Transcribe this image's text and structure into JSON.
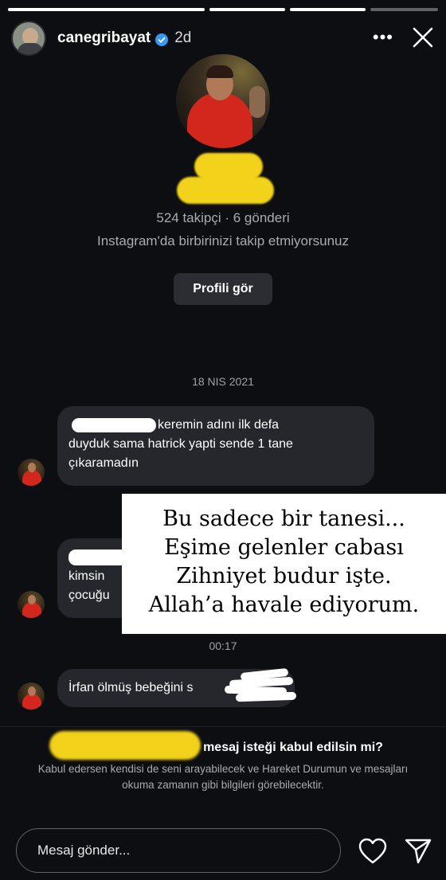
{
  "story": {
    "progress": [
      1.0,
      1.0,
      1.0,
      0.0
    ],
    "username": "canegribayat",
    "verified": true,
    "time_ago": "2d"
  },
  "profile": {
    "stats": "524 takipçi · 6 gönderi",
    "follow_note": "Instagram'da birbirinizi takip etmiyorsunuz",
    "view_profile_label": "Profili gör"
  },
  "chat": {
    "date_separator": "18 NIS 2021",
    "time_separator": "00:17",
    "messages": [
      {
        "line1": "keremin adını ilk defa",
        "line2": "duyduk sama hatrick yapti sende 1 tane",
        "line3": "çıkaramadın"
      },
      {
        "line1": "kimsin",
        "line2": "çocuğu"
      },
      {
        "line1": "İrfan ölmüş bebeğini s"
      }
    ]
  },
  "overlay": {
    "lines": [
      "Bu sadece bir tanesi...",
      "Eşime gelenler cabası",
      "Zihniyet budur işte.",
      "Allah’a havale ediyorum."
    ]
  },
  "request": {
    "title": "mesaj isteği kabul edilsin mi?",
    "description": "Kabul edersen kendisi de seni arayabilecek ve Hareket Durumun ve mesajları okuma zamanın gibi bilgileri görebilecektir."
  },
  "composer": {
    "placeholder": "Mesaj gönder..."
  },
  "icons": {
    "more": "more-horizontal-icon",
    "close": "close-icon",
    "verified": "verified-badge-icon",
    "heart": "heart-icon",
    "send": "send-icon"
  },
  "colors": {
    "background": "#0d0e12",
    "bubble": "#25272d",
    "redaction": "#f2d21a",
    "verified": "#3897f0"
  }
}
